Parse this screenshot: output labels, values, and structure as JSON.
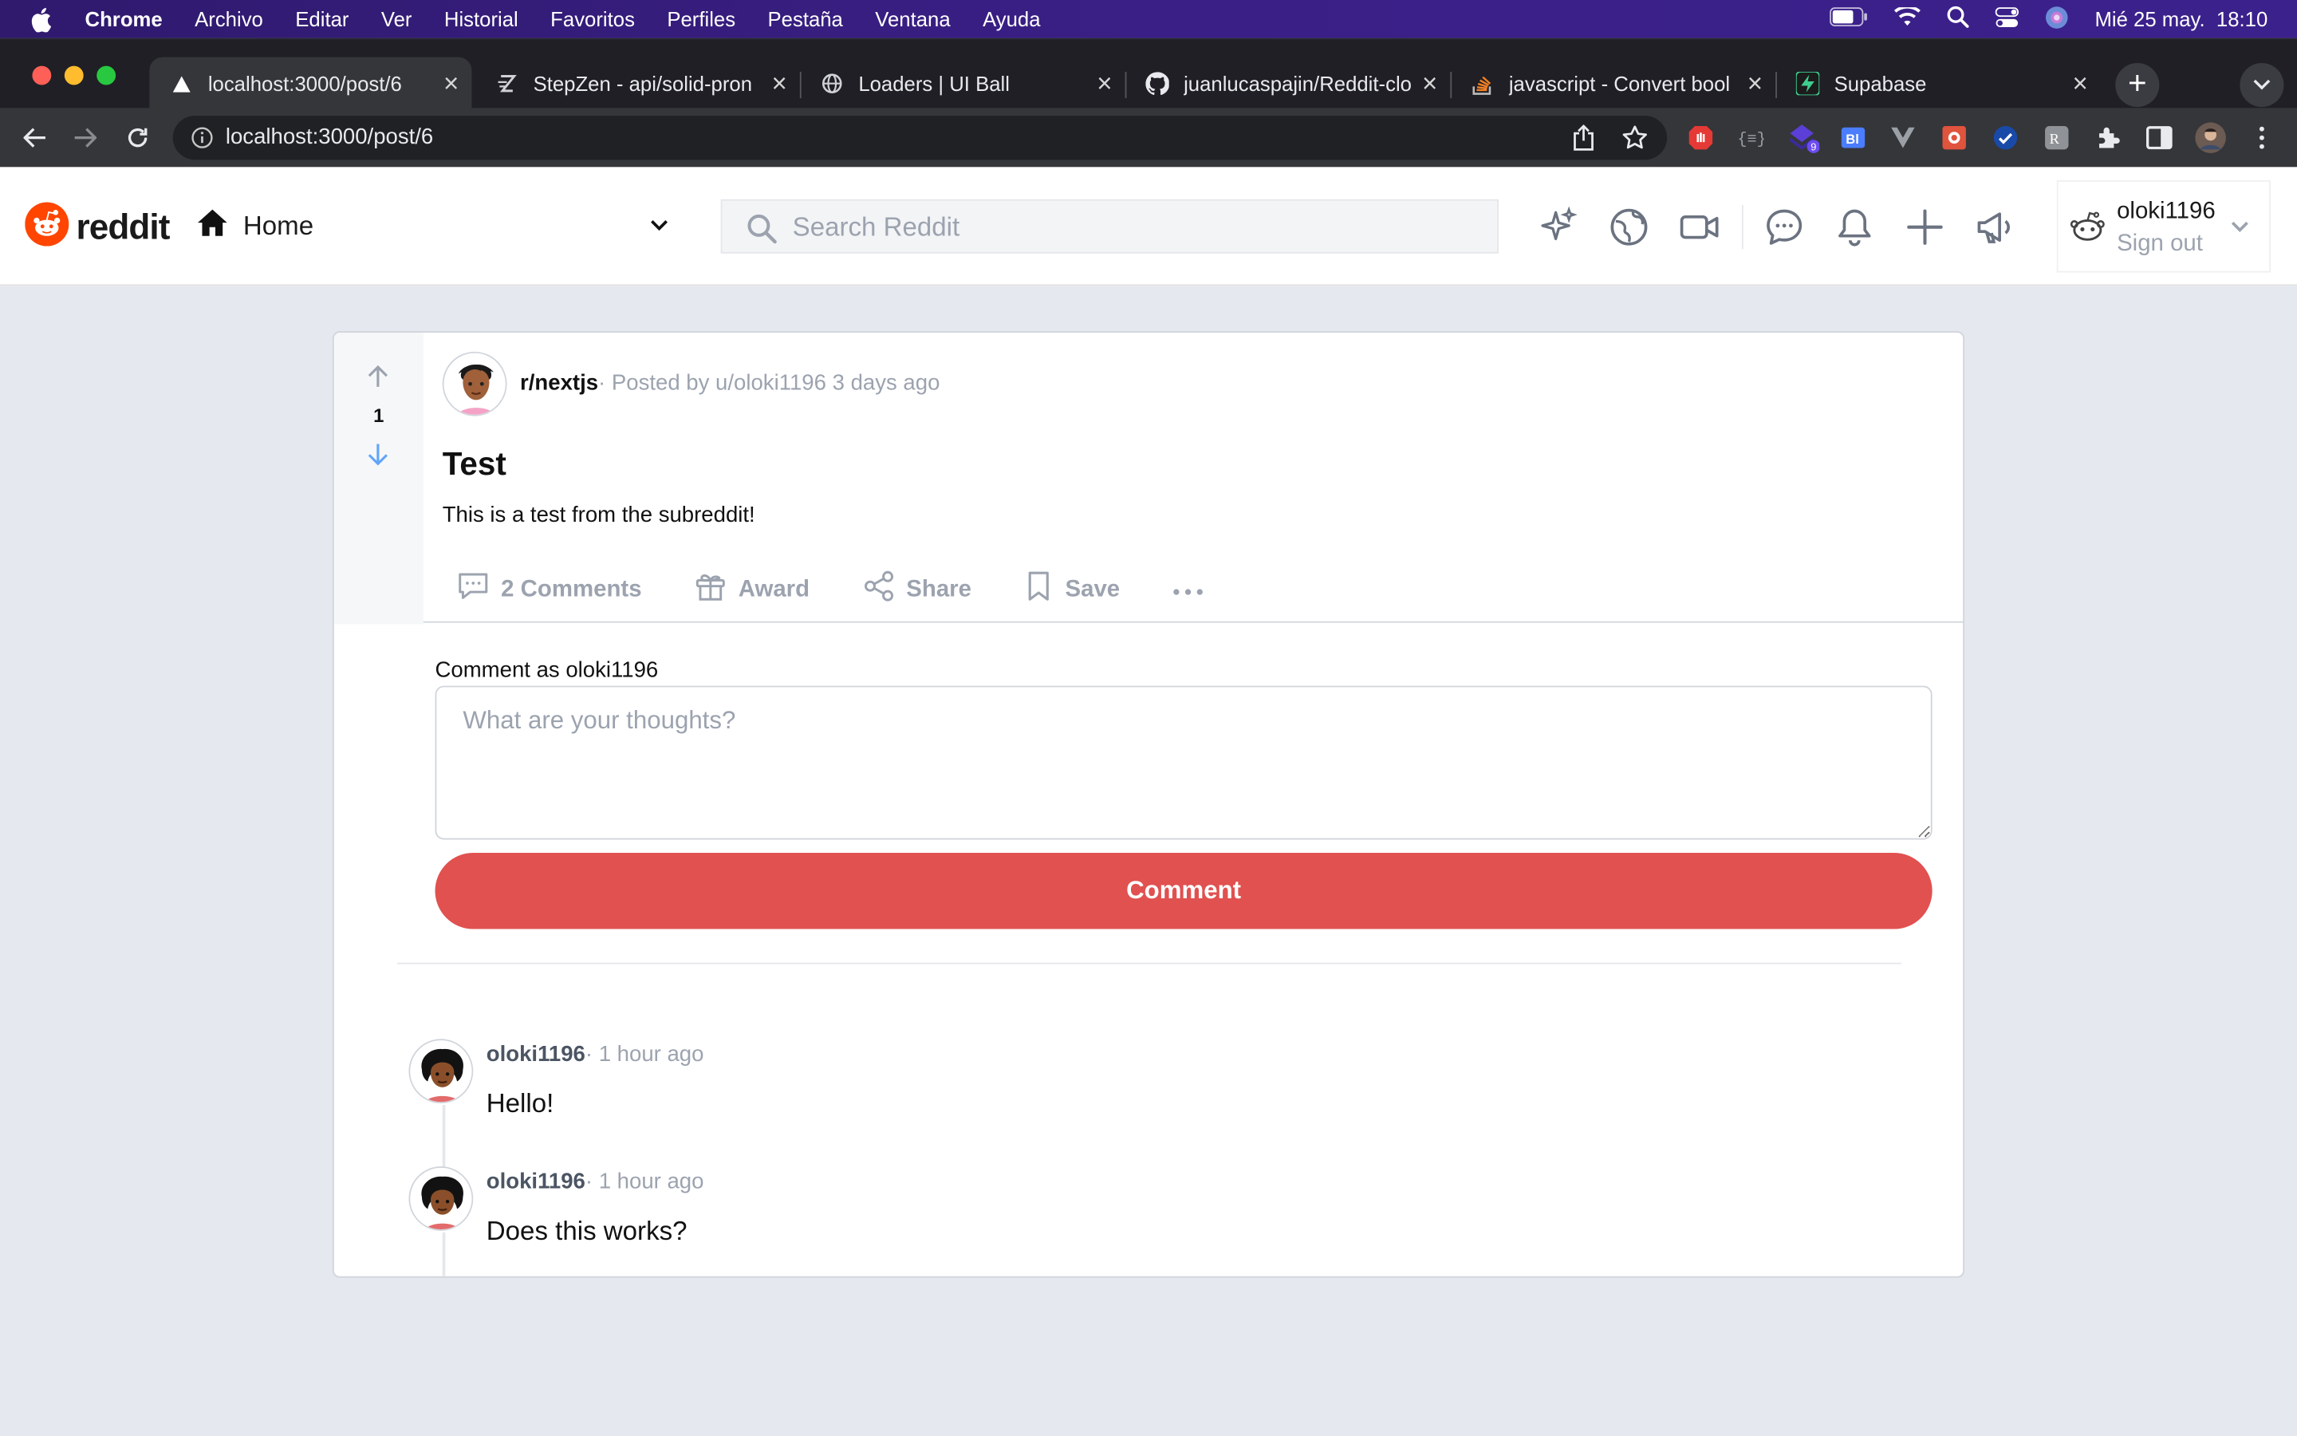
{
  "menubar": {
    "app": "Chrome",
    "items": [
      "Archivo",
      "Editar",
      "Ver",
      "Historial",
      "Favoritos",
      "Perfiles",
      "Pestaña",
      "Ventana",
      "Ayuda"
    ],
    "datetime": "Mié 25 may.  18:10"
  },
  "tabs": [
    {
      "title": "localhost:3000/post/6",
      "icon": "vercel-triangle-icon",
      "active": true
    },
    {
      "title": "StepZen - api/solid-pron",
      "icon": "stepzen-icon"
    },
    {
      "title": "Loaders | UI Ball",
      "icon": "globe-icon"
    },
    {
      "title": "juanlucaspajin/Reddit-clo",
      "icon": "github-icon"
    },
    {
      "title": "javascript - Convert bool",
      "icon": "stackoverflow-icon"
    },
    {
      "title": "Supabase",
      "icon": "supabase-icon"
    }
  ],
  "address": {
    "url": "localhost:3000/post/6"
  },
  "header": {
    "logo_text": "reddit",
    "home_label": "Home",
    "search_placeholder": "Search Reddit",
    "user": {
      "name": "oloki1196",
      "signout": "Sign out"
    }
  },
  "post": {
    "votes": "1",
    "subreddit": "r/nextjs",
    "meta": "· Posted by u/oloki1196 3 days ago",
    "title": "Test",
    "body": "This is a test from the subreddit!",
    "actions": {
      "comments": "2 Comments",
      "award": "Award",
      "share": "Share",
      "save": "Save"
    }
  },
  "comment_form": {
    "label": "Comment as oloki1196",
    "placeholder": "What are your thoughts?",
    "button": "Comment",
    "button_color": "#e05150"
  },
  "comments": [
    {
      "user": "oloki1196",
      "time": "· 1 hour ago",
      "text": "Hello!"
    },
    {
      "user": "oloki1196",
      "time": "· 1 hour ago",
      "text": "Does this works?"
    }
  ],
  "colors": {
    "reddit_orange": "#ff4500",
    "page_bg": "#e6e8f0",
    "vote_down": "#60a5fa"
  }
}
